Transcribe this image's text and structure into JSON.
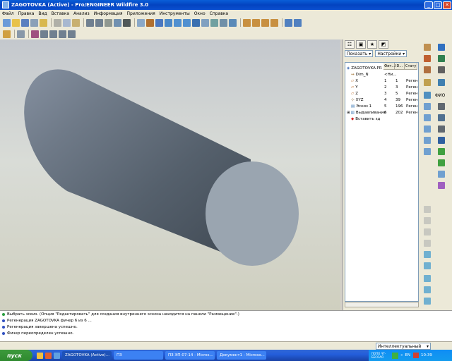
{
  "window": {
    "title": "ZAGOTOVKA (Active) - Pro/ENGINEER Wildfire 3.0"
  },
  "menu": [
    "Файл",
    "Правка",
    "Вид",
    "Вставка",
    "Анализ",
    "Информация",
    "Приложения",
    "Инструменты",
    "Окно",
    "Справка"
  ],
  "nav": {
    "show_label": "Показать ▾",
    "settings_label": "Настройки ▾",
    "columns": [
      "Фич...",
      "ID...",
      "Стату"
    ],
    "items": [
      {
        "label": "ZAGOTOVKA.PR",
        "col1": "",
        "col2": "",
        "col3": ""
      },
      {
        "label": "Dim_N",
        "col1": "<Ни...",
        "col2": "",
        "col3": ""
      },
      {
        "label": "X",
        "col1": "1",
        "col2": "1",
        "col3": "Реген"
      },
      {
        "label": "Y",
        "col1": "2",
        "col2": "3",
        "col3": "Реген"
      },
      {
        "label": "Z",
        "col1": "3",
        "col2": "5",
        "col3": "Реген"
      },
      {
        "label": "XYZ",
        "col1": "4",
        "col2": "39",
        "col3": "Реген"
      },
      {
        "label": "Эскиз 1",
        "col1": "5",
        "col2": "196",
        "col3": "Реген"
      },
      {
        "label": "Выдавливание",
        "col1": "6",
        "col2": "202",
        "col3": "Реген"
      },
      {
        "label": "Вставить зд",
        "col1": "",
        "col2": "",
        "col3": ""
      }
    ]
  },
  "right_tools": {
    "fio_label": "ФИО"
  },
  "messages": [
    "Выбрать эскиз. (Опция \"Редактировать\" для создания внутреннего эскиза находится на панели \"Размещение\".)",
    "Регенерация ZAGOTOVKA фичер 6 из 6 ...",
    "Регенерация завершена успешно.",
    "Фичер переопределен успешно."
  ],
  "status": {
    "filter": "Интеллектуальный"
  },
  "taskbar": {
    "start": "пуск",
    "tasks": [
      "ZAGOTOVKA (Active)...",
      "ПЗ",
      "ПЗ ЭП-07-14 - Micros...",
      "Документ1 - Microso..."
    ],
    "tray_text": "ПОПО ЧТ-БЕСОАЯ",
    "lang": "EN",
    "time": "10:39"
  },
  "colors": {
    "accent": "#0a4fd0",
    "cylinder_face": "#9aa5b0",
    "cylinder_body": "#6f7a86"
  }
}
